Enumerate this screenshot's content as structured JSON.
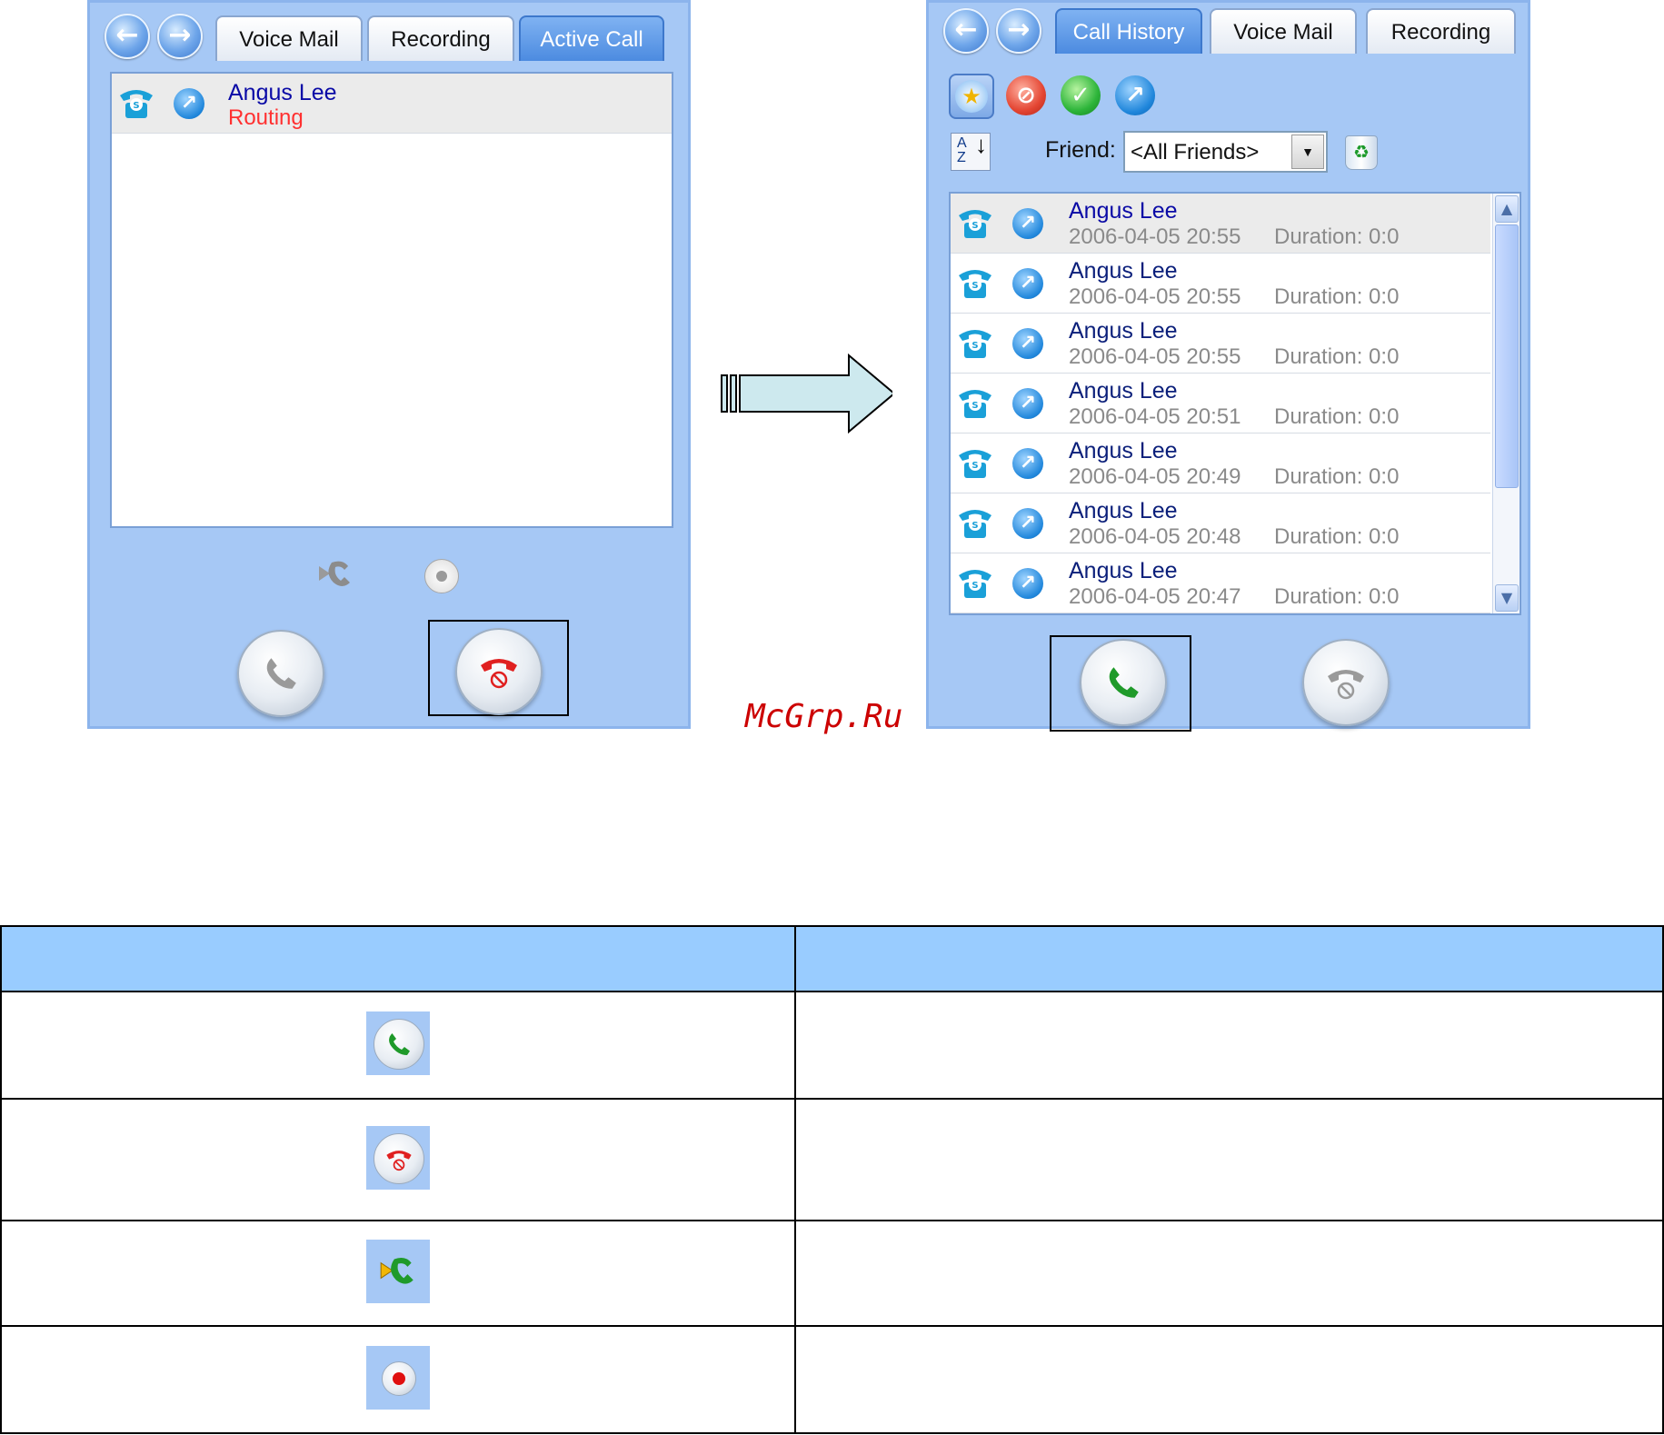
{
  "left_window": {
    "tabs": [
      "Voice Mail",
      "Recording",
      "Active Call"
    ],
    "active_tab": "Active Call",
    "active_call": {
      "name": "Angus Lee",
      "status": "Routing"
    },
    "icons": [
      "back-arrow-icon",
      "forward-arrow-icon",
      "skype-phone-icon",
      "link-arrow-icon",
      "transfer-call-icon",
      "record-icon",
      "answer-call-icon",
      "hang-up-icon"
    ]
  },
  "right_window": {
    "tabs": [
      "Call History",
      "Voice Mail",
      "Recording"
    ],
    "active_tab": "Call History",
    "friend_label": "Friend:",
    "friend_filter": "<All Friends>",
    "toolbar_icons": [
      "favorite-star-icon",
      "blocked-icon",
      "authorized-check-icon",
      "link-arrow-icon",
      "sort-az-icon",
      "recycle-bin-icon"
    ],
    "history": [
      {
        "name": "Angus Lee",
        "date": "2006-04-05 20:55",
        "duration": "Duration: 0:0"
      },
      {
        "name": "Angus Lee",
        "date": "2006-04-05 20:55",
        "duration": "Duration: 0:0"
      },
      {
        "name": "Angus Lee",
        "date": "2006-04-05 20:55",
        "duration": "Duration: 0:0"
      },
      {
        "name": "Angus Lee",
        "date": "2006-04-05 20:51",
        "duration": "Duration: 0:0"
      },
      {
        "name": "Angus Lee",
        "date": "2006-04-05 20:49",
        "duration": "Duration: 0:0"
      },
      {
        "name": "Angus Lee",
        "date": "2006-04-05 20:48",
        "duration": "Duration: 0:0"
      },
      {
        "name": "Angus Lee",
        "date": "2006-04-05 20:47",
        "duration": "Duration: 0:0"
      }
    ]
  },
  "watermark": "McGrp.Ru",
  "legend_table": {
    "rows": [
      {
        "icon": "answer-call-icon",
        "description": ""
      },
      {
        "icon": "hang-up-icon",
        "description": ""
      },
      {
        "icon": "transfer-call-icon",
        "description": ""
      },
      {
        "icon": "record-icon",
        "description": ""
      }
    ]
  },
  "colors": {
    "panel": "#a6c8f5",
    "active_tab": "#4c8be0",
    "name_text": "#0a0aa6",
    "status_text": "#ff3030",
    "table_header": "#99ccff",
    "watermark": "#cc0000"
  }
}
